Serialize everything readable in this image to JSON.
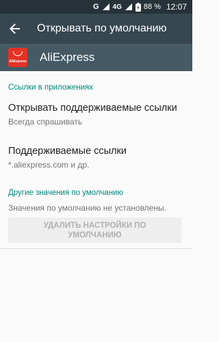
{
  "status_bar": {
    "network_label": "G",
    "network_type": "4G",
    "battery": "88 %",
    "time": "12:07",
    "icons": [
      "signal-icon",
      "battery-icon"
    ]
  },
  "toolbar": {
    "back_icon": "arrow-back-icon",
    "title": "Открывать по умолчанию"
  },
  "app": {
    "name": "AliExpress",
    "icon": "aliexpress-logo-icon",
    "icon_text": "AliExpress"
  },
  "sections": {
    "app_links": {
      "header": "Ссылки в приложениях",
      "open_links": {
        "title": "Открывать поддерживаемые ссылки",
        "value": "Всегда спрашивать"
      },
      "supported_links": {
        "title": "Поддерживаемые ссылки",
        "value": "*.aliexpress.com и др."
      }
    },
    "other_defaults": {
      "header": "Другие значения по умолчанию",
      "description": "Значения по умолчанию не установлены.",
      "clear_button_label": "УДАЛИТЬ НАСТРОЙКИ ПО\nУМОЛЧАНИЮ"
    }
  },
  "colors": {
    "status_bar": "#263238",
    "toolbar": "#37474f",
    "app_header": "#455a64",
    "accent": "#00897b",
    "background": "#fafafa"
  }
}
